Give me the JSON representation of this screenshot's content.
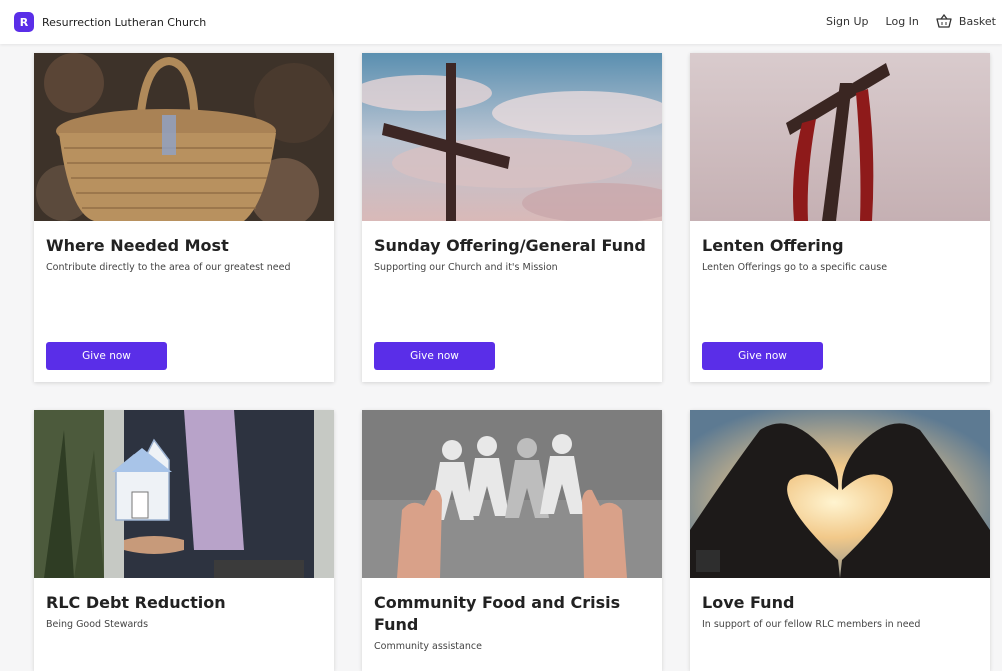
{
  "header": {
    "logo_letter": "R",
    "church_name": "Resurrection Lutheran Church",
    "signup": "Sign Up",
    "login": "Log In",
    "basket": "Basket"
  },
  "colors": {
    "accent": "#5a2ee8"
  },
  "funds": [
    {
      "title": "Where Needed Most",
      "description": "Contribute directly to the area of our greatest need",
      "button": "Give now",
      "image": "wicker-basket-photo"
    },
    {
      "title": "Sunday Offering/General Fund",
      "description": "Supporting our Church and it's Mission",
      "button": "Give now",
      "image": "cross-against-sky-photo"
    },
    {
      "title": "Lenten Offering",
      "description": "Lenten Offerings go to a specific cause",
      "button": "Give now",
      "image": "cross-with-red-cloth-photo"
    },
    {
      "title": "RLC Debt Reduction",
      "description": "Being Good Stewards",
      "image": "hand-holding-house-photo"
    },
    {
      "title": "Community Food and Crisis Fund",
      "description": "Community assistance",
      "image": "paper-chain-people-photo"
    },
    {
      "title": "Love Fund",
      "description": "In support of our fellow RLC members in need",
      "image": "heart-hands-sunset-photo"
    }
  ]
}
